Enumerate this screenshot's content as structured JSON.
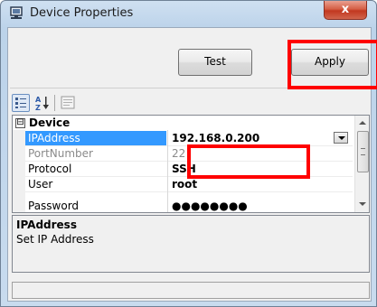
{
  "window": {
    "title": "Device Properties",
    "close_glyph": "x"
  },
  "buttons": {
    "test_label": "Test",
    "apply_label": "Apply"
  },
  "toolbar": {
    "icons": [
      "categorized-icon",
      "alphabetical-sort-icon",
      "property-pages-icon"
    ]
  },
  "grid": {
    "category": "Device",
    "expand_glyph": "⊟",
    "properties": [
      {
        "name": "IPAddress",
        "value": "192.168.0.200",
        "selected": true
      },
      {
        "name": "PortNumber",
        "value": "22",
        "selected": false
      },
      {
        "name": "Protocol",
        "value": "SSH",
        "selected": false
      },
      {
        "name": "User",
        "value": "root",
        "selected": false
      },
      {
        "name": "Password",
        "value": "●●●●●●●●",
        "selected": false
      }
    ]
  },
  "help": {
    "title": "IPAddress",
    "description": "Set IP Address"
  },
  "status": {
    "text": ""
  },
  "colors": {
    "selection": "#3399ff",
    "highlight_box": "#ff0000",
    "close_button": "#c2371f"
  }
}
